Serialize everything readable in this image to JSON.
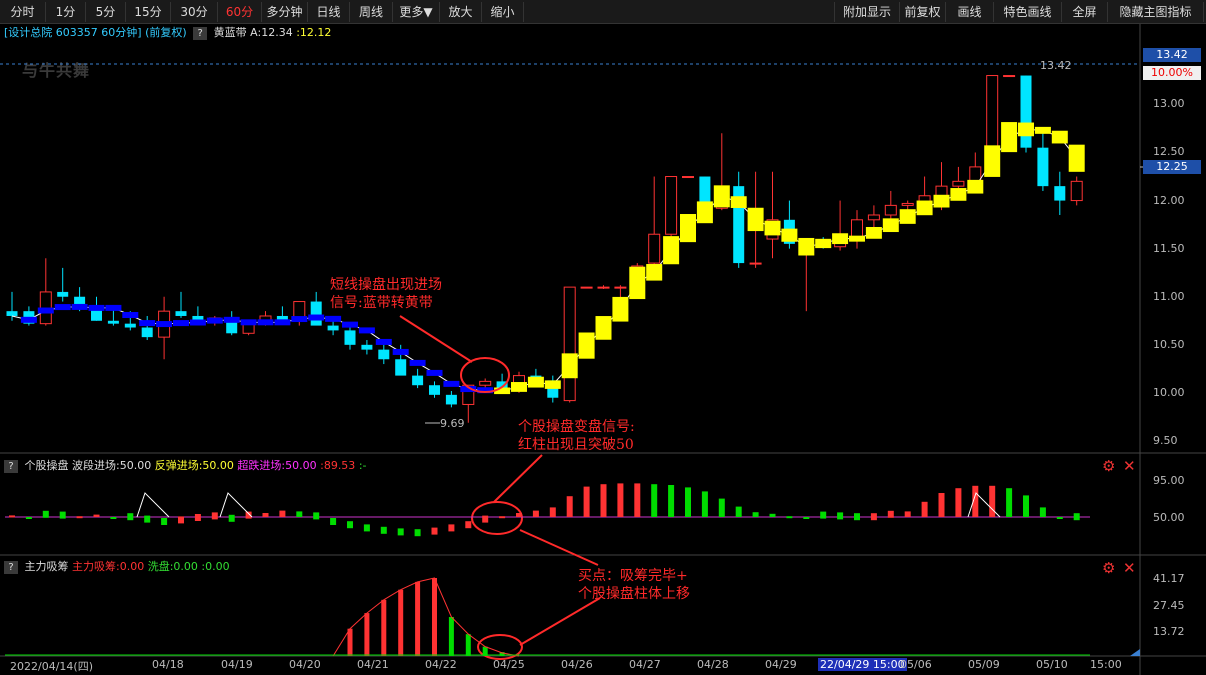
{
  "toolbar": {
    "periods": [
      "分时",
      "1分",
      "5分",
      "15分",
      "30分",
      "60分",
      "多分钟",
      "日线",
      "周线",
      "更多▼",
      "放大",
      "缩小"
    ],
    "active": "60分",
    "right": [
      "附加显示",
      "前复权",
      "画线",
      "特色画线",
      "全屏",
      "隐藏主图指标"
    ]
  },
  "main": {
    "title": "[设计总院 603357 60分钟]",
    "adjust": "(前复权)",
    "indicator_name": "黄蓝带",
    "indicator_a": "A:12.34",
    "indicator_b": ":12.12",
    "watermark": "与牛共舞",
    "price_high_badge": "13.42",
    "pct_badge": "10.00%",
    "price_last_badge": "12.25",
    "high_marker": "13.42",
    "low_marker": "9.69",
    "y_ticks": [
      "13.00",
      "12.50",
      "12.00",
      "11.50",
      "11.00",
      "10.50",
      "10.00",
      "9.50"
    ]
  },
  "panel2": {
    "name": "个股操盘",
    "s1": "波段进场:50.00",
    "s2": "反弹进场:50.00",
    "s3": "超跌进场:50.00",
    "s4": ":89.53",
    "s5": ":-",
    "y_ticks": [
      "95.00",
      "50.00"
    ]
  },
  "panel3": {
    "name": "主力吸筹",
    "s1": "主力吸筹:0.00",
    "s2": "洗盘:0.00",
    "s3": ":0.00",
    "y_ticks": [
      "41.17",
      "27.45",
      "13.72"
    ]
  },
  "dates": [
    "2022/04/14(四)",
    "04/18",
    "04/19",
    "04/20",
    "04/21",
    "04/22",
    "04/25",
    "04/26",
    "04/27",
    "04/28",
    "04/29",
    "22/04/29 15:00",
    "05/06",
    "05/09",
    "05/10",
    "15:00"
  ],
  "annotations": {
    "a1_line1": "短线操盘出现进场",
    "a1_line2": "信号:蓝带转黄带",
    "a2_line1": "个股操盘变盘信号:",
    "a2_line2": "红柱出现且突破50",
    "a3_line1": "买点：吸筹完毕+",
    "a3_line2": "个股操盘柱体上移"
  },
  "colors": {
    "up": "#ff3333",
    "down": "#00e5ff",
    "yellow_band": "#ffff00",
    "blue_band": "#0000ff",
    "purple_line": "#cc33cc",
    "green": "#00dd00",
    "accent_red": "#ff2a2a"
  },
  "chart_data": {
    "type": "candlestick",
    "ylim": [
      9.45,
      13.55
    ],
    "bar_count": 64,
    "ohlc": [
      [
        10.85,
        11.05,
        10.75,
        10.8
      ],
      [
        10.85,
        10.9,
        10.7,
        10.72
      ],
      [
        10.72,
        11.4,
        10.7,
        11.05
      ],
      [
        11.05,
        11.3,
        10.95,
        11.0
      ],
      [
        11.0,
        11.1,
        10.85,
        10.9
      ],
      [
        10.9,
        11.0,
        10.75,
        10.75
      ],
      [
        10.75,
        10.9,
        10.7,
        10.72
      ],
      [
        10.72,
        10.85,
        10.65,
        10.68
      ],
      [
        10.68,
        10.8,
        10.55,
        10.58
      ],
      [
        10.58,
        11.0,
        10.35,
        10.85
      ],
      [
        10.85,
        11.05,
        10.78,
        10.8
      ],
      [
        10.8,
        10.9,
        10.72,
        10.75
      ],
      [
        10.75,
        10.8,
        10.7,
        10.78
      ],
      [
        10.78,
        10.85,
        10.6,
        10.62
      ],
      [
        10.62,
        10.75,
        10.6,
        10.72
      ],
      [
        10.72,
        10.85,
        10.7,
        10.8
      ],
      [
        10.8,
        10.9,
        10.75,
        10.75
      ],
      [
        10.75,
        10.95,
        10.7,
        10.95
      ],
      [
        10.95,
        11.05,
        10.75,
        10.7
      ],
      [
        10.7,
        10.75,
        10.6,
        10.65
      ],
      [
        10.65,
        10.7,
        10.45,
        10.5
      ],
      [
        10.5,
        10.55,
        10.4,
        10.45
      ],
      [
        10.45,
        10.5,
        10.3,
        10.35
      ],
      [
        10.35,
        10.5,
        10.25,
        10.18
      ],
      [
        10.18,
        10.25,
        10.05,
        10.08
      ],
      [
        10.08,
        10.12,
        9.95,
        9.98
      ],
      [
        9.98,
        10.02,
        9.85,
        9.88
      ],
      [
        9.88,
        10.05,
        9.69,
        10.08
      ],
      [
        10.08,
        10.15,
        10.05,
        10.12
      ],
      [
        10.12,
        10.2,
        10.05,
        10.05
      ],
      [
        10.05,
        10.22,
        10.0,
        10.18
      ],
      [
        10.18,
        10.25,
        10.1,
        10.13
      ],
      [
        10.13,
        10.18,
        9.9,
        9.95
      ],
      [
        9.92,
        11.1,
        9.9,
        11.1
      ],
      [
        11.1,
        11.1,
        11.1,
        11.1
      ],
      [
        11.1,
        11.12,
        11.08,
        11.1
      ],
      [
        11.1,
        11.12,
        10.88,
        11.1
      ],
      [
        11.2,
        11.35,
        11.2,
        11.32
      ],
      [
        11.35,
        12.25,
        11.2,
        11.65
      ],
      [
        11.65,
        12.25,
        11.6,
        12.25
      ],
      [
        12.25,
        12.25,
        12.25,
        12.25
      ],
      [
        12.25,
        12.25,
        11.9,
        11.92
      ],
      [
        11.92,
        12.7,
        11.9,
        12.15
      ],
      [
        12.15,
        12.3,
        11.3,
        11.35
      ],
      [
        11.35,
        12.3,
        11.3,
        11.35
      ],
      [
        11.6,
        12.3,
        11.4,
        11.8
      ],
      [
        11.8,
        12.0,
        11.5,
        11.55
      ],
      [
        11.55,
        11.6,
        10.85,
        11.55
      ],
      [
        11.55,
        11.62,
        11.5,
        11.52
      ],
      [
        11.52,
        12.0,
        11.48,
        11.6
      ],
      [
        11.6,
        11.9,
        11.5,
        11.8
      ],
      [
        11.8,
        11.95,
        11.7,
        11.85
      ],
      [
        11.85,
        12.1,
        11.7,
        11.95
      ],
      [
        11.95,
        12.0,
        11.8,
        11.97
      ],
      [
        11.97,
        12.25,
        11.9,
        12.05
      ],
      [
        12.05,
        12.4,
        11.9,
        12.15
      ],
      [
        12.15,
        12.35,
        12.05,
        12.2
      ],
      [
        12.2,
        12.5,
        12.1,
        12.35
      ],
      [
        12.35,
        13.3,
        12.3,
        13.3
      ],
      [
        13.3,
        13.3,
        13.3,
        13.3
      ],
      [
        13.3,
        13.3,
        12.5,
        12.55
      ],
      [
        12.55,
        12.7,
        12.1,
        12.15
      ],
      [
        12.15,
        12.3,
        11.85,
        12.0
      ],
      [
        12.0,
        12.25,
        11.95,
        12.2
      ]
    ]
  }
}
